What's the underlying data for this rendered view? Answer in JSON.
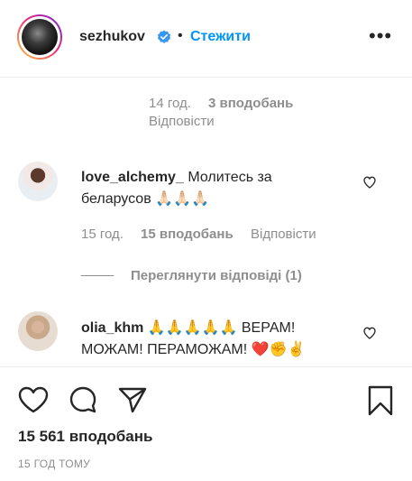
{
  "header": {
    "username": "sezhukov",
    "separator": "•",
    "follow_label": "Стежити",
    "more_icon": "more-dots-icon"
  },
  "prev_comment_meta": {
    "time": "14 год.",
    "likes": "3 вподобань",
    "reply": "Відповісти"
  },
  "comments": [
    {
      "username": "love_alchemy_",
      "text_line1": "Молитесь за",
      "text_line2": "беларусов 🙏🏻🙏🏻🙏🏻",
      "time": "15 год.",
      "likes": "15 вподобань",
      "reply": "Відповісти",
      "view_replies": "Переглянути відповіді (1)"
    },
    {
      "username": "olia_khm",
      "text_line1": "🙏🙏🙏🙏🙏 ВЕРАМ!",
      "text_line2": "МОЖАМ! ПЕРАМОЖАМ! ❤️✊✌️"
    }
  ],
  "footer": {
    "likes_count": "15 561 вподобань",
    "time_ago": "15 ГОД ТОМУ"
  },
  "colors": {
    "link_blue": "#0095f6",
    "meta_grey": "#8e8e8e",
    "text": "#262626"
  }
}
